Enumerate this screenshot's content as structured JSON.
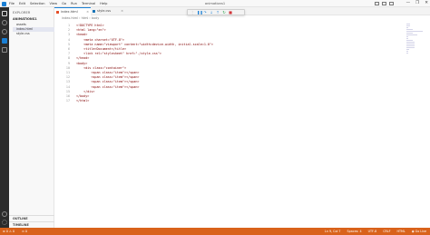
{
  "window": {
    "menu": [
      "File",
      "Edit",
      "Selection",
      "View",
      "Go",
      "Run",
      "Terminal",
      "Help"
    ],
    "title": "animations1",
    "controls": [
      "—",
      "❐",
      "✕"
    ]
  },
  "sidebar": {
    "header": "EXPLORER",
    "folder": "ANIMATIONS1",
    "files": [
      "assets",
      "index.html",
      "style.css"
    ],
    "selected_index": 1,
    "bottom": [
      "OUTLINE",
      "TIMELINE"
    ]
  },
  "tabs": [
    {
      "label": "index.html",
      "active": true
    },
    {
      "label": "style.css",
      "active": false
    }
  ],
  "breadcrumb": "index.html › html › body",
  "editor": {
    "lines": [
      "<!DOCTYPE html>",
      "<html lang=\"en\">",
      "<head>",
      "    <meta charset=\"UTF-8\">",
      "    <meta name=\"viewport\" content=\"width=device-width, initial-scale=1.0\">",
      "    <title>Document</title>",
      "    <link rel=\"stylesheet\" href=\"./style.css\">",
      "</head>",
      "<body>",
      "    <div class=\"container\">",
      "        <span class=\"item\"></span>",
      "        <span class=\"item\"></span>",
      "        <span class=\"item\"></span>",
      "        <span class=\"item\"></span>",
      "    </div>",
      "</body>",
      "</html>"
    ]
  },
  "statusbar": {
    "left": [
      "⊗ 0 ⚠ 0",
      "⊙ 0"
    ],
    "right": [
      "Ln 9, Col 7",
      "Spaces: 4",
      "UTF-8",
      "CRLF",
      "HTML",
      "◉ Go Live"
    ]
  },
  "colors": {
    "accent": "#1a7fd4",
    "statusbar": "#d9621b",
    "html_icon": "#e44d26",
    "css_icon": "#1572b6"
  }
}
